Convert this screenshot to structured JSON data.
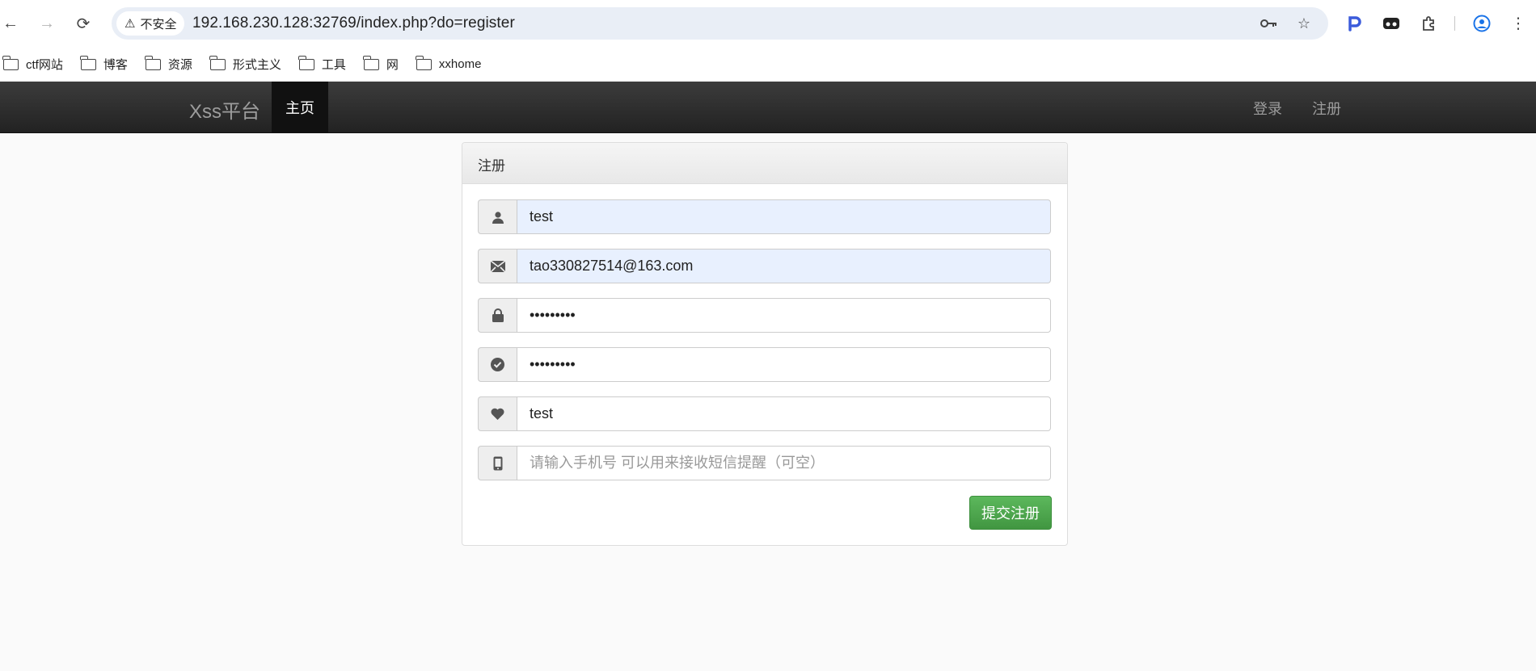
{
  "browser": {
    "security_label": "不安全",
    "url": "192.168.230.128:32769/index.php?do=register"
  },
  "bookmarks": [
    {
      "label": "ctf网站"
    },
    {
      "label": "博客"
    },
    {
      "label": "资源"
    },
    {
      "label": "形式主义"
    },
    {
      "label": "工具"
    },
    {
      "label": "网"
    },
    {
      "label": "xxhome"
    }
  ],
  "navbar": {
    "brand": "Xss平台",
    "home": "主页",
    "login": "登录",
    "register": "注册"
  },
  "form": {
    "heading": "注册",
    "username": {
      "value": "test",
      "icon": "user-icon"
    },
    "email": {
      "value": "tao330827514@163.com",
      "icon": "envelope-icon"
    },
    "password": {
      "value": "•••••••••",
      "icon": "lock-icon"
    },
    "password_confirm": {
      "value": "•••••••••",
      "icon": "check-circle-icon"
    },
    "nickname": {
      "value": "test",
      "icon": "heart-icon"
    },
    "phone": {
      "value": "",
      "placeholder": "请输入手机号 可以用来接收短信提醒（可空）",
      "icon": "phone-icon"
    },
    "submit": "提交注册"
  }
}
